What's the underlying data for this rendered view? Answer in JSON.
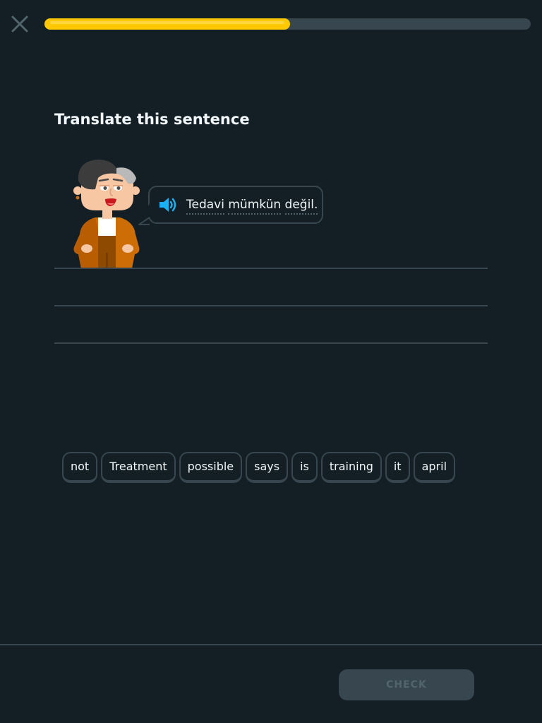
{
  "header": {
    "close_icon": "close-icon",
    "progress": 0.505
  },
  "exercise": {
    "title": "Translate this sentence",
    "speaker_icon": "speaker-icon",
    "prompt_words": [
      "Tedavi",
      "mümkün",
      "değil."
    ]
  },
  "word_bank": [
    "not",
    "Treatment",
    "possible",
    "says",
    "is",
    "training",
    "it",
    "april"
  ],
  "footer": {
    "check_label": "CHECK"
  },
  "colors": {
    "background": "#131f24",
    "progress_fill": "#ffc800",
    "progress_track": "#37464f",
    "speaker": "#1cb0f6",
    "text": "#f1f7fb",
    "disabled_button": "#37464f",
    "disabled_text": "#52656d"
  }
}
